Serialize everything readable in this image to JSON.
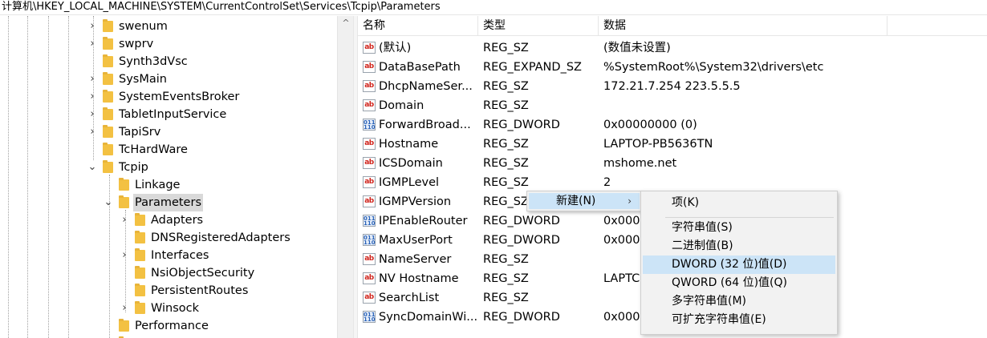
{
  "address_bar": {
    "path": "计算机\\HKEY_LOCAL_MACHINE\\SYSTEM\\CurrentControlSet\\Services\\Tcpip\\Parameters"
  },
  "tree": {
    "nodes": [
      {
        "label": "swenum",
        "expander": "›"
      },
      {
        "label": "swprv",
        "expander": "›"
      },
      {
        "label": "Synth3dVsc",
        "expander": ""
      },
      {
        "label": "SysMain",
        "expander": "›"
      },
      {
        "label": "SystemEventsBroker",
        "expander": "›"
      },
      {
        "label": "TabletInputService",
        "expander": "›"
      },
      {
        "label": "TapiSrv",
        "expander": "›"
      },
      {
        "label": "TcHardWare",
        "expander": ""
      },
      {
        "label": "Tcpip",
        "expander": "⌄"
      },
      {
        "label": "Linkage",
        "expander": ""
      },
      {
        "label": "Parameters",
        "expander": "⌄"
      },
      {
        "label": "Adapters",
        "expander": "›"
      },
      {
        "label": "DNSRegisteredAdapters",
        "expander": ""
      },
      {
        "label": "Interfaces",
        "expander": "›"
      },
      {
        "label": "NsiObjectSecurity",
        "expander": ""
      },
      {
        "label": "PersistentRoutes",
        "expander": ""
      },
      {
        "label": "Winsock",
        "expander": "›"
      },
      {
        "label": "Performance",
        "expander": ""
      }
    ],
    "scroll_up_glyph": "^"
  },
  "list": {
    "columns": [
      "名称",
      "类型",
      "数据"
    ],
    "rows": [
      {
        "icon": "string-value-icon",
        "glyph": "ab",
        "name": "(默认)",
        "type": "REG_SZ",
        "data": "(数值未设置)"
      },
      {
        "icon": "string-value-icon",
        "glyph": "ab",
        "name": "DataBasePath",
        "type": "REG_EXPAND_SZ",
        "data": "%SystemRoot%\\System32\\drivers\\etc"
      },
      {
        "icon": "string-value-icon",
        "glyph": "ab",
        "name": "DhcpNameSer...",
        "type": "REG_SZ",
        "data": "172.21.7.254 223.5.5.5"
      },
      {
        "icon": "string-value-icon",
        "glyph": "ab",
        "name": "Domain",
        "type": "REG_SZ",
        "data": ""
      },
      {
        "icon": "binary-value-icon",
        "glyph": "011\n110",
        "name": "ForwardBroad...",
        "type": "REG_DWORD",
        "data": "0x00000000 (0)"
      },
      {
        "icon": "string-value-icon",
        "glyph": "ab",
        "name": "Hostname",
        "type": "REG_SZ",
        "data": "LAPTOP-PB5636TN"
      },
      {
        "icon": "string-value-icon",
        "glyph": "ab",
        "name": "ICSDomain",
        "type": "REG_SZ",
        "data": "mshome.net"
      },
      {
        "icon": "string-value-icon",
        "glyph": "ab",
        "name": "IGMPLevel",
        "type": "REG_SZ",
        "data": "2"
      },
      {
        "icon": "string-value-icon",
        "glyph": "ab",
        "name": "IGMPVersion",
        "type": "REG_SZ",
        "data": ""
      },
      {
        "icon": "binary-value-icon",
        "glyph": "011\n110",
        "name": "IPEnableRouter",
        "type": "REG_DWORD",
        "data": "0x000"
      },
      {
        "icon": "binary-value-icon",
        "glyph": "011\n110",
        "name": "MaxUserPort",
        "type": "REG_DWORD",
        "data": "0x000"
      },
      {
        "icon": "string-value-icon",
        "glyph": "ab",
        "name": "NameServer",
        "type": "REG_SZ",
        "data": ""
      },
      {
        "icon": "string-value-icon",
        "glyph": "ab",
        "name": "NV Hostname",
        "type": "REG_SZ",
        "data": "LAPTC"
      },
      {
        "icon": "string-value-icon",
        "glyph": "ab",
        "name": "SearchList",
        "type": "REG_SZ",
        "data": ""
      },
      {
        "icon": "binary-value-icon",
        "glyph": "011\n110",
        "name": "SyncDomainWi...",
        "type": "REG_DWORD",
        "data": "0x000"
      }
    ]
  },
  "context_menu": {
    "new_label": "新建(N)",
    "new_arrow": "›",
    "submenu": [
      {
        "label": "项(K)",
        "highlighted": false
      },
      {
        "label": "字符串值(S)",
        "highlighted": false
      },
      {
        "label": "二进制值(B)",
        "highlighted": false
      },
      {
        "label": "DWORD (32 位)值(D)",
        "highlighted": true
      },
      {
        "label": "QWORD (64 位)值(Q)",
        "highlighted": false
      },
      {
        "label": "多字符串值(M)",
        "highlighted": false
      },
      {
        "label": "可扩充字符串值(E)",
        "highlighted": false
      }
    ]
  }
}
